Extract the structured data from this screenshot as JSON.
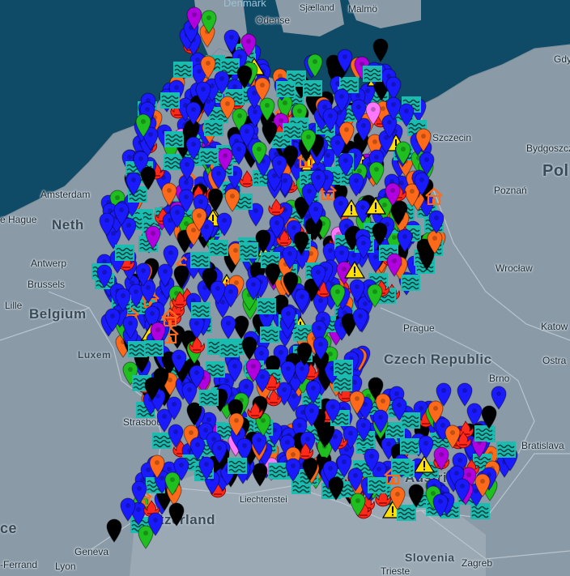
{
  "map": {
    "places": {
      "denmark": "Denmark",
      "sjaelland": "Sjælland",
      "malmo": "Malmö",
      "odense": "Odense",
      "szczecin": "Szczecin",
      "gdy": "Gdy",
      "bydgoszcz": "Bydgoszcz",
      "pol": "Pol",
      "poznan": "Poznań",
      "amsterdam": "Amsterdam",
      "hague": "e Hague",
      "neth": "Neth",
      "antwerp": "Antwerp",
      "brussels": "Brussels",
      "lille": "Lille",
      "belgium": "Belgium",
      "wroclaw": "Wrocław",
      "katow": "Katow",
      "prague": "Prague",
      "czech_republic": "Czech Republic",
      "ostra": "Ostra",
      "luxem": "Luxem",
      "brno": "Brno",
      "strasbourg": "Strasbou",
      "bratislava": "Bratislava",
      "austria": "Austria",
      "liechtenstein": "Liechtenstei",
      "switzerland": "Switzerland",
      "geneva": "Geneva",
      "ferrand": "-Ferrand",
      "lyon": "Lyon",
      "slovenia": "Slovenia",
      "zagreb": "Zagreb",
      "trieste": "Trieste",
      "ce": "ce"
    },
    "colors": {
      "sea": "#0f4a66",
      "land": "#8a9aa7",
      "land_light": "#9aa9b5",
      "border": "#b9c5ce",
      "marker_blue": "#1a1aff",
      "marker_black": "#000000",
      "marker_green": "#1fbf1f",
      "marker_orange": "#ff6a1a",
      "marker_purple": "#b000e0",
      "marker_pink": "#ff77ff",
      "marker_red": "#ff2a1a",
      "flood_teal": "#1bbcb0",
      "warning_yellow": "#ffe000"
    },
    "marker_types": [
      "blue-pin",
      "black-pin",
      "green-pin",
      "orange-pin",
      "purple-pin",
      "pink-pin",
      "fire-icon",
      "flood-icon",
      "warning-icon",
      "house-icon"
    ]
  }
}
